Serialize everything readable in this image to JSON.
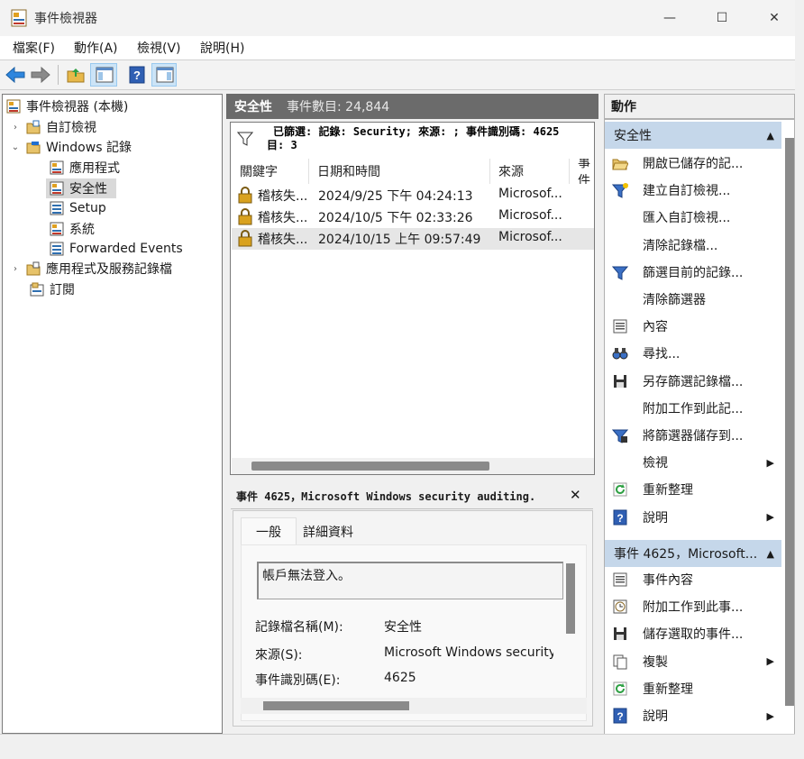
{
  "window": {
    "title": "事件檢視器",
    "min": "—",
    "max": "☐",
    "close": "✕"
  },
  "menu": [
    "檔案(F)",
    "動作(A)",
    "檢視(V)",
    "說明(H)"
  ],
  "tree": {
    "root": "事件檢視器 (本機)",
    "custom_views": "自訂檢視",
    "windows_logs": "Windows 記錄",
    "logs": [
      "應用程式",
      "安全性",
      "Setup",
      "系統",
      "Forwarded Events"
    ],
    "app_service_logs": "應用程式及服務記錄檔",
    "subscriptions": "訂閱"
  },
  "middle": {
    "header_title": "安全性",
    "header_count": "事件數目: 24,844",
    "filter_line1": "已篩選: 記錄: Security; 來源: ; 事件識別碼: 4625",
    "filter_line2": "目: 3",
    "columns": [
      "關鍵字",
      "日期和時間",
      "來源",
      "事件"
    ],
    "rows": [
      {
        "keyword": "稽核失...",
        "datetime": "2024/9/25 下午 04:24:13",
        "source": "Microsof..."
      },
      {
        "keyword": "稽核失...",
        "datetime": "2024/10/5 下午 02:33:26",
        "source": "Microsof..."
      },
      {
        "keyword": "稽核失...",
        "datetime": "2024/10/15 上午 09:57:49",
        "source": "Microsof..."
      }
    ]
  },
  "detail": {
    "title": "事件 4625，Microsoft Windows security auditing.",
    "close": "✕",
    "tabs": [
      "一般",
      "詳細資料"
    ],
    "message": "帳戶無法登入。",
    "fields": [
      {
        "label": "記錄檔名稱(M):",
        "value": "安全性"
      },
      {
        "label": "來源(S):",
        "value": "Microsoft Windows security a"
      },
      {
        "label": "事件識別碼(E):",
        "value": "4625"
      }
    ]
  },
  "actions": {
    "title": "動作",
    "section1": "安全性",
    "section1_items": [
      {
        "label": "開啟已儲存的記...",
        "icon": "folder-open-icon"
      },
      {
        "label": "建立自訂檢視...",
        "icon": "filter-new-icon"
      },
      {
        "label": "匯入自訂檢視...",
        "icon": ""
      },
      {
        "label": "清除記錄檔...",
        "icon": ""
      },
      {
        "label": "篩選目前的記錄...",
        "icon": "filter-icon"
      },
      {
        "label": "清除篩選器",
        "icon": ""
      },
      {
        "label": "內容",
        "icon": "properties-icon"
      },
      {
        "label": "尋找...",
        "icon": "binoculars-icon"
      },
      {
        "label": "另存篩選記錄檔...",
        "icon": "save-icon"
      },
      {
        "label": "附加工作到此記...",
        "icon": ""
      },
      {
        "label": "將篩選器儲存到...",
        "icon": "filter-save-icon"
      },
      {
        "label": "檢視",
        "icon": "",
        "submenu": true
      },
      {
        "label": "重新整理",
        "icon": "refresh-icon"
      },
      {
        "label": "說明",
        "icon": "help-icon",
        "submenu": true
      }
    ],
    "section2": "事件 4625，Microsoft...",
    "section2_items": [
      {
        "label": "事件內容",
        "icon": "properties-icon"
      },
      {
        "label": "附加工作到此事...",
        "icon": "task-clock-icon"
      },
      {
        "label": "儲存選取的事件...",
        "icon": "save-icon"
      },
      {
        "label": "複製",
        "icon": "copy-icon",
        "submenu": true
      },
      {
        "label": "重新整理",
        "icon": "refresh-icon"
      },
      {
        "label": "說明",
        "icon": "help-icon",
        "submenu": true
      }
    ],
    "collapse_glyph": "▲",
    "submenu_glyph": "▶"
  }
}
